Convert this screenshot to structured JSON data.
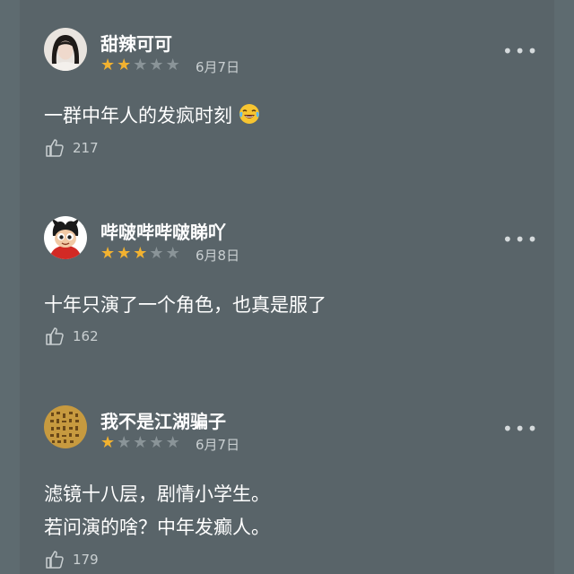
{
  "comments": [
    {
      "username": "甜辣可可",
      "rating": 2,
      "date": "6月7日",
      "lines": [
        "一群中年人的发疯时刻"
      ],
      "likes": "217",
      "avatar_icon": "woman-portrait-avatar",
      "emoji": "face-with-tears-of-joy"
    },
    {
      "username": "哔啵哔哔啵睇吖",
      "rating": 3,
      "date": "6月8日",
      "lines": [
        "十年只演了一个角色，也真是服了"
      ],
      "likes": "162",
      "avatar_icon": "astro-boy-avatar"
    },
    {
      "username": "我不是江湖骗子",
      "rating": 1,
      "date": "6月7日",
      "lines": [
        "滤镜十八层，剧情小学生。",
        "若问演的啥？中年发癫人。"
      ],
      "likes": "179",
      "avatar_icon": "calligraphy-scroll-avatar"
    }
  ],
  "more_glyph": "•••",
  "colors": {
    "background": "#596469",
    "star_on": "#f2b230",
    "star_off": "#8a9498"
  }
}
